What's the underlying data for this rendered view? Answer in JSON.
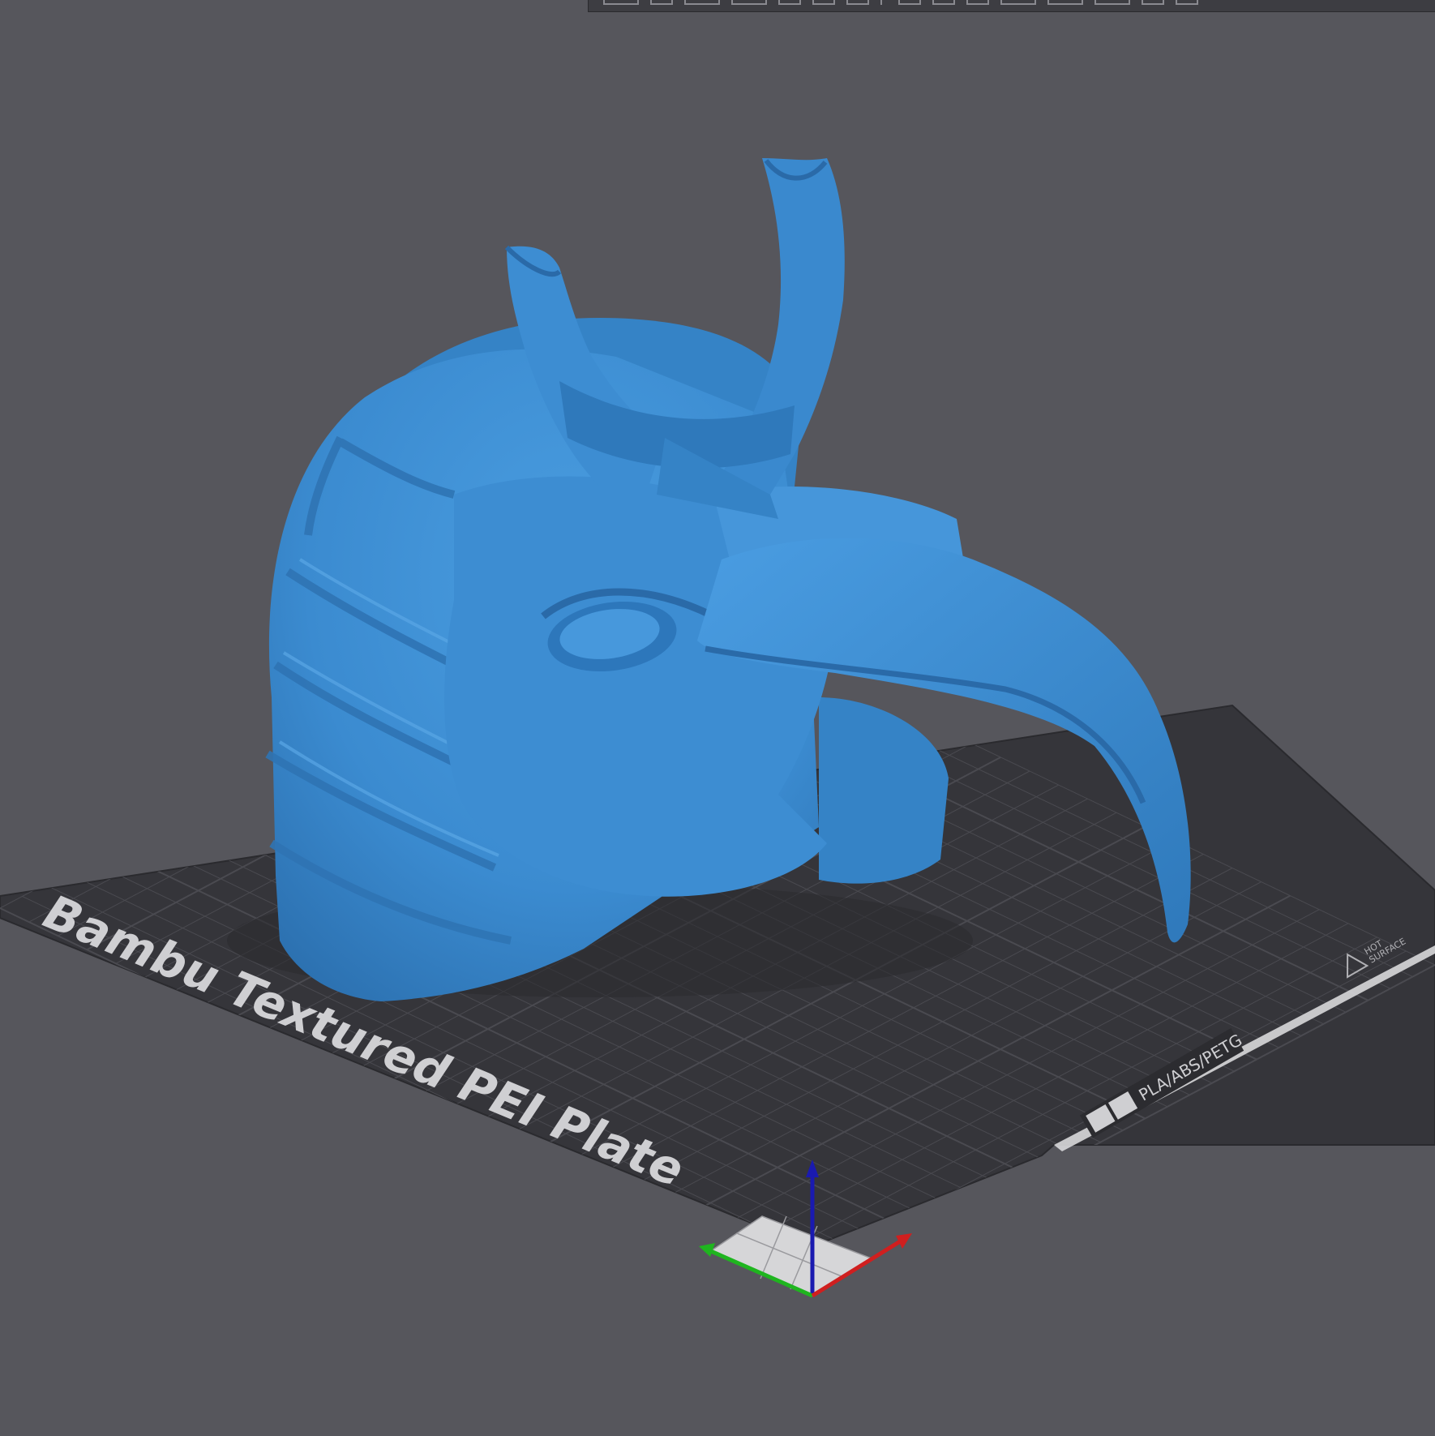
{
  "plate": {
    "name_label": "Bambu Textured PEI Plate",
    "material_label": "PLA/ABS/PETG",
    "warning_label_line1": "HOT",
    "warning_label_line2": "SURFACE"
  },
  "toolbar": {
    "icons": [
      "move-icon",
      "rotate-icon",
      "scale-icon",
      "auto-orient-icon",
      "arrange-icon",
      "split-icon",
      "cut-icon",
      "support-paint-icon",
      "seam-paint-icon",
      "color-paint-icon",
      "measure-icon",
      "text-icon",
      "assembly-icon",
      "layers-icon",
      "variable-height-icon",
      "lay-on-face-icon"
    ]
  },
  "model": {
    "name": "ibis-headed head sculpture",
    "color": "#3b8bd0"
  },
  "axes": {
    "x_color": "#d01f1f",
    "y_color": "#1fb51f",
    "z_color": "#1a1ab0"
  },
  "colors": {
    "background": "#56565c",
    "plate_surface": "#35353a",
    "grid_line": "#4a4a50",
    "plate_text": "#cfcfd2"
  }
}
